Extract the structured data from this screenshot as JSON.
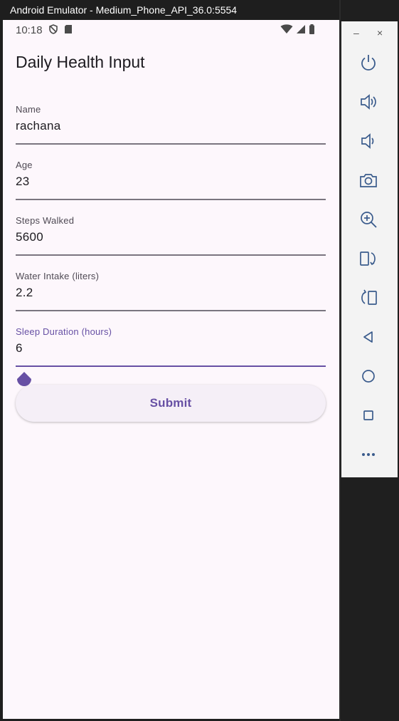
{
  "window": {
    "title": "Android Emulator - Medium_Phone_API_36.0:5554"
  },
  "status_bar": {
    "time": "10:18"
  },
  "app_bar": {
    "title": "Daily Health Input"
  },
  "form": {
    "fields": [
      {
        "label": "Name",
        "value": "rachana"
      },
      {
        "label": "Age",
        "value": "23"
      },
      {
        "label": "Steps Walked",
        "value": "5600"
      },
      {
        "label": "Water Intake (liters)",
        "value": "2.2"
      },
      {
        "label": "Sleep Duration (hours)",
        "value": "6"
      }
    ],
    "submit_label": "Submit"
  },
  "toolbar": {
    "minimize_label": "–",
    "close_label": "×",
    "buttons": [
      "power-icon",
      "volume-up-icon",
      "volume-down-icon",
      "camera-icon",
      "zoom-icon",
      "rotate-left-icon",
      "rotate-right-icon",
      "back-icon",
      "home-icon",
      "overview-icon",
      "more-icon"
    ]
  },
  "colors": {
    "accent": "#6750a4",
    "background": "#fdf7fc",
    "text": "#1d1b20"
  }
}
